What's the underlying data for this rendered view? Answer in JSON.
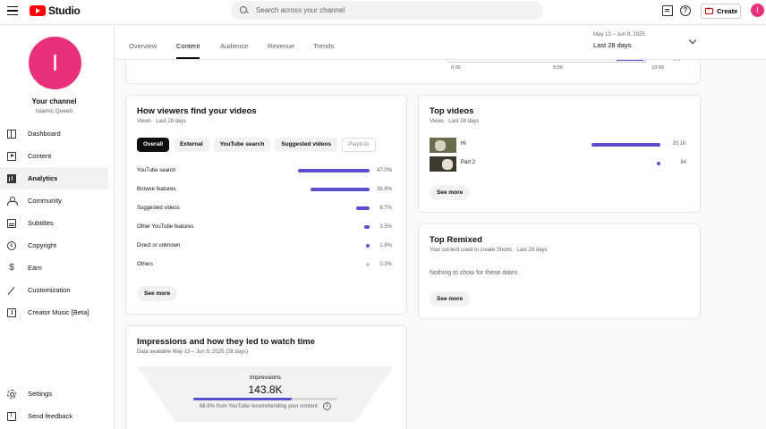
{
  "header": {
    "app_name": "Studio",
    "search_placeholder": "Search across your channel",
    "create_label": "Create",
    "avatar_letter": "I"
  },
  "sidebar": {
    "avatar_letter": "I",
    "channel_title": "Your channel",
    "channel_name": "Islamic Queen",
    "items": [
      {
        "label": "Dashboard",
        "icon": "dashboard-icon"
      },
      {
        "label": "Content",
        "icon": "content-icon"
      },
      {
        "label": "Analytics",
        "icon": "analytics-icon",
        "active": true
      },
      {
        "label": "Community",
        "icon": "community-icon"
      },
      {
        "label": "Subtitles",
        "icon": "subtitles-icon"
      },
      {
        "label": "Copyright",
        "icon": "copyright-icon"
      },
      {
        "label": "Earn",
        "icon": "earn-icon"
      },
      {
        "label": "Customization",
        "icon": "customization-icon"
      },
      {
        "label": "Creator Music [Beta]",
        "icon": "creator-music-icon"
      }
    ],
    "bottom_items": [
      {
        "label": "Settings",
        "icon": "settings-icon"
      },
      {
        "label": "Send feedback",
        "icon": "feedback-icon"
      }
    ]
  },
  "tabs": [
    "Overview",
    "Content",
    "Audience",
    "Revenue",
    "Trends"
  ],
  "active_tab": "Content",
  "date_range": {
    "sub": "May 13 – Jun 9, 2025",
    "main": "Last 28 days"
  },
  "top_chart_stub": {
    "x_ticks": [
      "0:00",
      "9:59",
      "19:58"
    ],
    "y_tick": "0%"
  },
  "how_viewers": {
    "title": "How viewers find your videos",
    "subtitle": "Views · Last 28 days",
    "chips": [
      "Overall",
      "External",
      "YouTube search",
      "Suggested videos",
      "Playlists"
    ],
    "sources": [
      {
        "label": "YouTube search",
        "value": "47.0%",
        "fraction": 0.47
      },
      {
        "label": "Browse features",
        "value": "38.8%",
        "fraction": 0.388
      },
      {
        "label": "Suggested videos",
        "value": "8.7%",
        "fraction": 0.087
      },
      {
        "label": "Other YouTube features",
        "value": "3.5%",
        "fraction": 0.035
      },
      {
        "label": "Direct or unknown",
        "value": "1.8%",
        "fraction": 0.018
      },
      {
        "label": "Others",
        "value": "0.3%",
        "fraction": 0.003
      }
    ],
    "see_more": "See more"
  },
  "top_videos": {
    "title": "Top videos",
    "subtitle": "Views · Last 28 days",
    "videos": [
      {
        "title": "Hi",
        "value": "20.1K",
        "fraction": 0.96
      },
      {
        "title": "Part 2",
        "value": "84",
        "fraction": 0.004
      }
    ],
    "see_more": "See more"
  },
  "top_remixed": {
    "title": "Top Remixed",
    "subtitle": "Your content used to create Shorts · Last 28 days",
    "empty": "Nothing to show for these dates",
    "see_more": "See more"
  },
  "impressions": {
    "title": "Impressions and how they led to watch time",
    "subtitle": "Data available May 13 – Jun 9, 2025 (28 days)",
    "label": "Impressions",
    "value": "143.8K",
    "fraction": 0.686,
    "note": "68.6% from YouTube recommending your content"
  }
}
